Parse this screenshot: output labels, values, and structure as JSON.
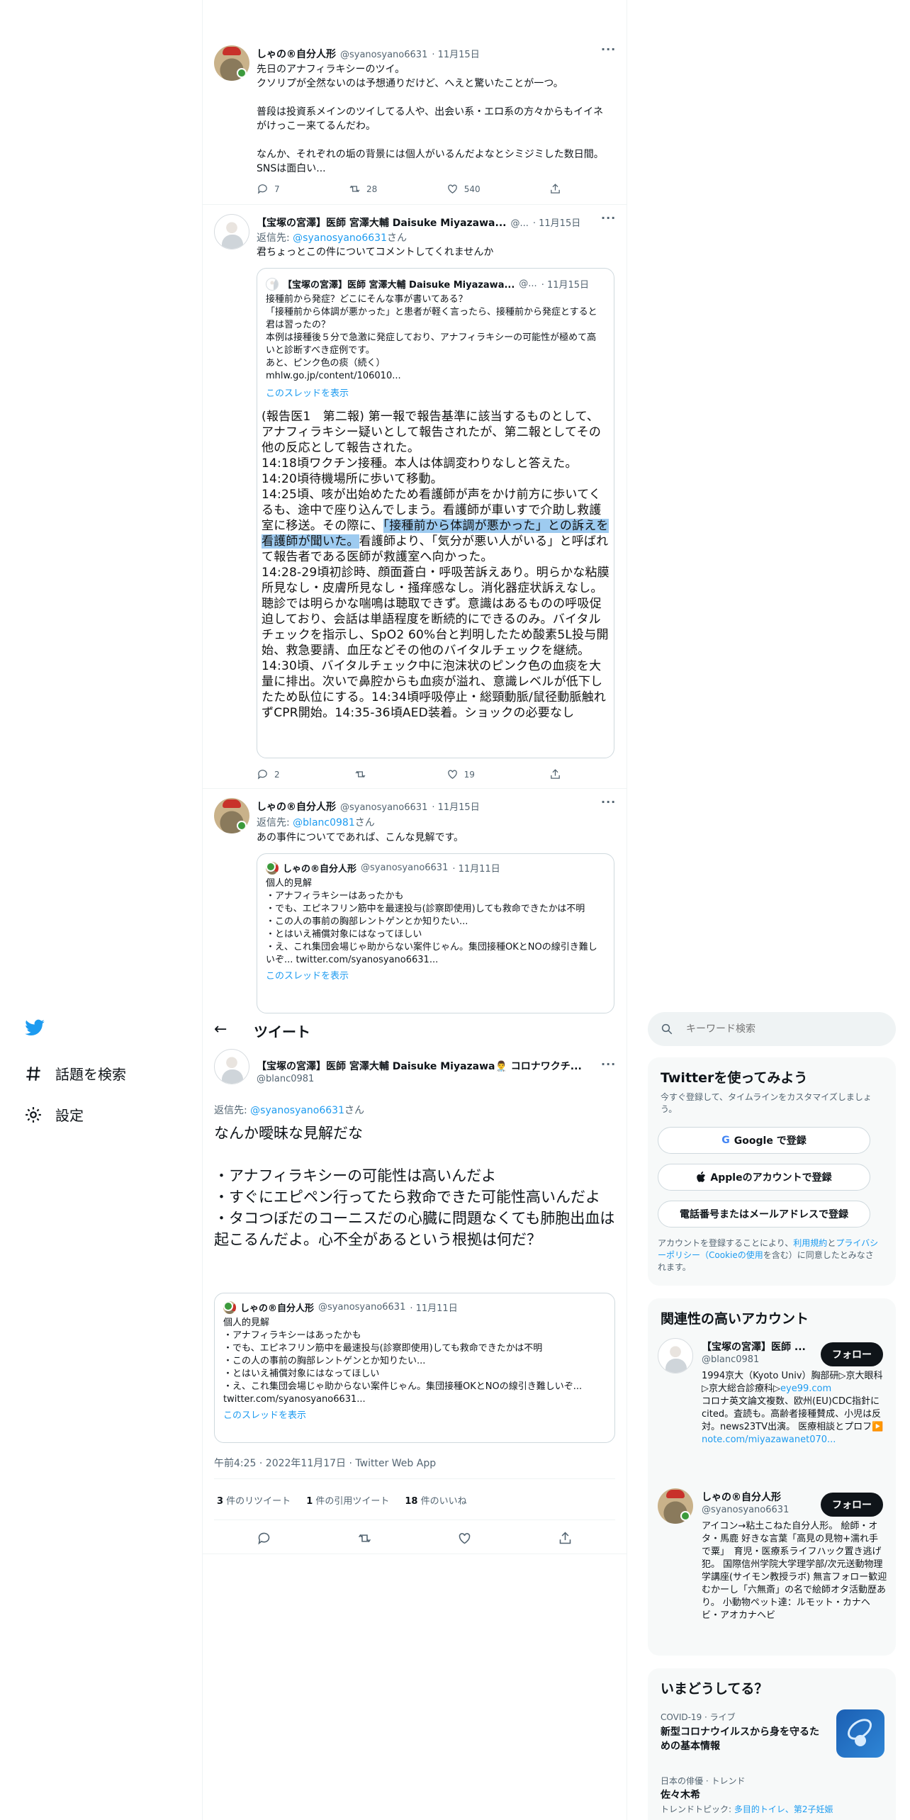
{
  "colors": {
    "accent": "#1d9bf0",
    "text": "#0f1419",
    "muted": "#536471",
    "border": "#eff3f4"
  },
  "thread": {
    "tweet1": {
      "name": "しゃの®自分人形",
      "handle": "@syanosyano6631",
      "date": "· 11月15日",
      "text": "先日のアナフィラキシーのツイ。\nクソリプが全然ないのは予想通りだけど、へえと驚いたことが一つ。\n\n普段は投資系メインのツイしてる人や、出会い系・エロ系の方々からもイイネがけっこー来てるんだわ。\n\nなんか、それぞれの垢の背景には個人がいるんだよなとシミジミした数日間。SNSは面白い...",
      "reply_count": "7",
      "retweet_count": "28",
      "like_count": "540"
    },
    "tweet2": {
      "name": "【宝塚の宮澤】医師 宮澤大輔 Daisuke Miyazawa...",
      "handle": "@...",
      "date": "· 11月15日",
      "reply_prefix": "返信先: ",
      "reply_to": "@syanosyano6631",
      "reply_suffix": "さん",
      "text": "君ちょっとこの件についてコメントしてくれませんか",
      "quote": {
        "name": "【宝塚の宮澤】医師 宮澤大輔 Daisuke Miyazawa...",
        "handle": "@...",
        "date": "· 11月15日",
        "text": "接種前から発症？どこにそんな事が書いてある？\n「接種前から体調が悪かった」と患者が軽く言ったら、接種前から発症とすると君は習ったの？\n本例は接種後５分で急激に発症しており、アナフィラキシーの可能性が極めて高いと診断すべき症例です。\nあと、ピンク色の痰（続く）\nmhlw.go.jp/content/106010...",
        "thread_link": "このスレッドを表示"
      },
      "doc": {
        "before": "(報告医1　第二報) 第一報で報告基準に該当するものとして、アナフィラキシー疑いとして報告されたが、第二報としてその他の反応として報告された。\n14:18頃ワクチン接種。本人は体調変わりなしと答えた。14:20頃待機場所に歩いて移動。\n14:25頃、咳が出始めたため看護師が声をかけ前方に歩いてくるも、途中で座り込んでしまう。看護師が車いすで介助し救護室に移送。その際に、",
        "highlight": "「接種前から体調が悪かった」との訴えを看護師が聞いた。",
        "after": "看護師より、「気分が悪い人がいる」と呼ばれて報告者である医師が救護室へ向かった。\n14:28-29頃初診時、顔面蒼白・呼吸苦訴えあり。明らかな粘膜所見なし・皮膚所見なし・掻痒感なし。消化器症状訴えなし。聴診では明らかな喘鳴は聴取できず。意識はあるものの呼吸促迫しており、会話は単語程度を断続的にできるのみ。バイタルチェックを指示し、SpO2 60%台と判明したため酸素5L投与開始、救急要請、血圧などその他のバイタルチェックを継続。\n14:30頃、バイタルチェック中に泡沫状のピンク色の血痰を大量に排出。次いで鼻腔からも血痰が溢れ、意識レベルが低下したため臥位にする。14:34頃呼吸停止・総頸動脈/鼠径動脈触れずCPR開始。14:35-36頃AED装着。ショックの必要なし"
      },
      "reply_count": "2",
      "retweet_count": "",
      "like_count": "19"
    },
    "tweet3": {
      "name": "しゃの®自分人形",
      "handle": "@syanosyano6631",
      "date": "· 11月15日",
      "reply_prefix": "返信先: ",
      "reply_to": "@blanc0981",
      "reply_suffix": "さん",
      "text": "あの事件についてであれば、こんな見解です。",
      "quote": {
        "name": "しゃの®自分人形",
        "handle": "@syanosyano6631",
        "date": "· 11月11日",
        "text": "個人的見解\n・アナフィラキシーはあったかも\n・でも、エピネフリン筋中を最速投与(診察即使用)しても救命できたかは不明\n・この人の事前の胸部レントゲンとか知りたい...\n・とはいえ補償対象にはなってほしい\n・え、これ集団会場じゃ助からない案件じゃん。集団接種OKとNOの線引き難しいぞ... twitter.com/syanosyano6631...",
        "thread_link": "このスレッドを表示"
      }
    }
  },
  "sidebar": {
    "items": [
      {
        "label": "話題を検索",
        "icon": "hashtag-icon"
      },
      {
        "label": "設定",
        "icon": "gear-icon"
      }
    ]
  },
  "header": {
    "title": "ツイート"
  },
  "main_tweet": {
    "name": "【宝塚の宮澤】医師 宮澤大輔 Daisuke Miyazawa👨‍⚕️ コロナワクチ...",
    "handle": "@blanc0981",
    "reply_prefix": "返信先: ",
    "reply_to": "@syanosyano6631",
    "reply_suffix": "さん",
    "text": "なんか曖昧な見解だな\n\n・アナフィラキシーの可能性は高いんだよ\n・すぐにエピペン行ってたら救命できた可能性高いんだよ\n・タコつぼだのコーニスだの心臓に問題なくても肺胞出血は起こるんだよ。心不全があるという根拠は何だ？",
    "quote": {
      "name": "しゃの®自分人形",
      "handle": "@syanosyano6631",
      "date": "· 11月11日",
      "text": "個人的見解\n・アナフィラキシーはあったかも\n・でも、エピネフリン筋中を最速投与(診察即使用)しても救命できたかは不明\n・この人の事前の胸部レントゲンとか知りたい...\n・とはいえ補償対象にはなってほしい\n・え、これ集団会場じゃ助からない案件じゃん。集団接種OKとNOの線引き難しいぞ... twitter.com/syanosyano6631...",
      "thread_link": "このスレッドを表示"
    },
    "timestamp": "午前4:25 · 2022年11月17日 · Twitter Web App",
    "stats": {
      "retweets_num": "3",
      "retweets_label": " 件のリツイート",
      "quotes_num": "1",
      "quotes_label": " 件の引用ツイート",
      "likes_num": "18",
      "likes_label": " 件のいいね"
    }
  },
  "search": {
    "placeholder": "キーワード検索"
  },
  "signup": {
    "title": "Twitterを使ってみよう",
    "subtitle": "今すぐ登録して、タイムラインをカスタマイズしましょう。",
    "google": "Google で登録",
    "apple": "Appleのアカウントで登録",
    "phone": "電話番号またはメールアドレスで登録",
    "legal_1": "アカウントを登録することにより、",
    "legal_terms": "利用規約",
    "legal_2": "と",
    "legal_privacy": "プライバシーポリシー（Cookieの使用",
    "legal_3": "を含む）に同意したとみなされます。"
  },
  "related": {
    "title": "関連性の高いアカウント",
    "follow": "フォロー",
    "accounts": [
      {
        "name": "【宝塚の宮澤】医師 ...",
        "handle": "@blanc0981",
        "bio_1": "1994京大（Kyoto Univ）胸部研▷京大眼科▷京大総合診療科▷",
        "bio_link1": "eye99.com",
        "bio_2": "\nコロナ英文論文複数、欧州(EU)CDC指針にcited。査読も。高齢者接種賛成、小児は反対。news23TV出演。 医療相談とプロフ▶️\n",
        "bio_link2": "note.com/miyazawanet070..."
      },
      {
        "name": "しゃの®自分人形",
        "handle": "@syanosyano6631",
        "bio_1": "アイコン→粘土こねた自分人形。 絵師・オタ・馬鹿 好きな言葉「高見の見物+濡れ手で粟」　育児・医療系ライフハック置き逃げ犯。 国際信州学院大学理学部/次元送動物理学講座(サイモン教授ラボ) 無言フォロー歓迎　むかーし「六無斎」の名で絵師オタ活動歴あり。 小動物ペット達：ルモット・カナヘビ・アオカナヘビ",
        "bio_link1": "",
        "bio_2": "",
        "bio_link2": ""
      }
    ]
  },
  "trends": {
    "title": "いまどうしてる？",
    "items": [
      {
        "meta": "COVID-19 · ライブ",
        "title": "新型コロナウイルスから身を守るための基本情報"
      },
      {
        "meta": "日本の俳優 · トレンド",
        "title": "佐々木希",
        "topics_label": "トレンドトピック: ",
        "topics": "多目的トイレ、第2子妊娠"
      }
    ]
  }
}
